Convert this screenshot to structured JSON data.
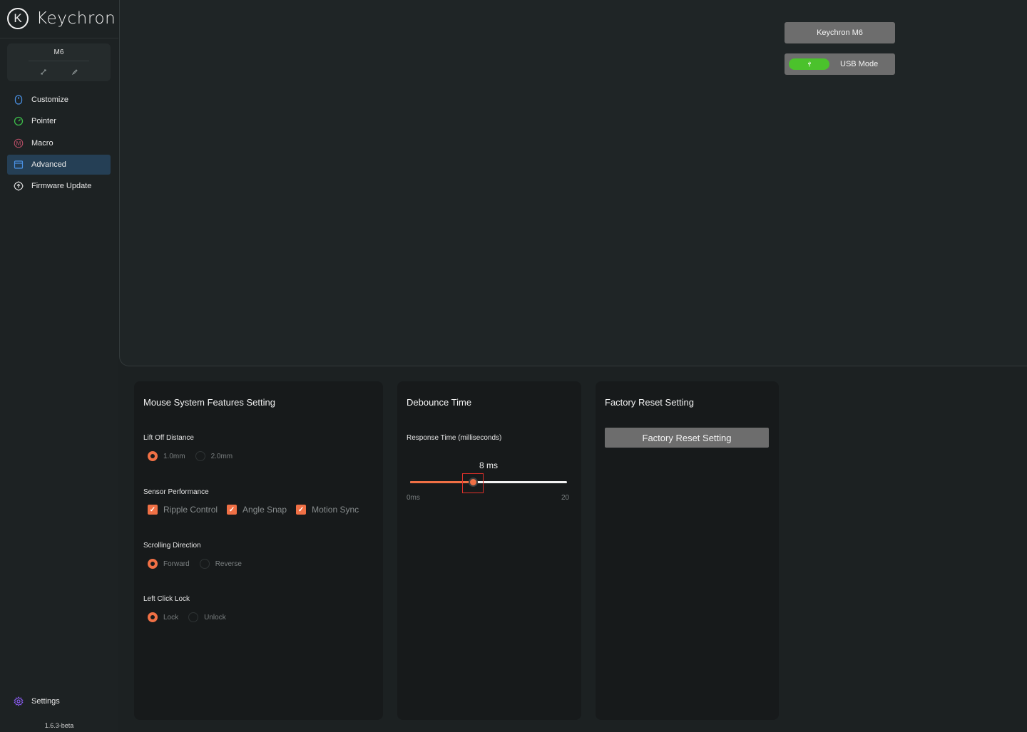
{
  "sidebar": {
    "brand": "Keychron",
    "device": {
      "name": "M6"
    },
    "nav": [
      {
        "label": "Customize",
        "icon": "mouse-icon",
        "color": "#4a90e2"
      },
      {
        "label": "Pointer",
        "icon": "pointer-speed-icon",
        "color": "#3dbb4a"
      },
      {
        "label": "Macro",
        "icon": "macro-m-icon",
        "color": "#c0506a"
      },
      {
        "label": "Advanced",
        "icon": "advanced-window-icon",
        "color": "#4a90e2",
        "active": true
      },
      {
        "label": "Firmware Update",
        "icon": "firmware-update-icon",
        "color": "#e6e6e6"
      }
    ],
    "settings_label": "Settings",
    "version": "1.6.3-beta"
  },
  "header": {
    "model_label": "Keychron M6",
    "mode_label": "USB Mode"
  },
  "features": {
    "title": "Mouse System Features Setting",
    "lift_off": {
      "label": "Lift Off Distance",
      "options": [
        "1.0mm",
        "2.0mm"
      ],
      "selected": "1.0mm"
    },
    "sensor": {
      "label": "Sensor Performance",
      "options": [
        "Ripple Control",
        "Angle Snap",
        "Motion Sync"
      ],
      "checked": [
        "Ripple Control",
        "Angle Snap",
        "Motion Sync"
      ]
    },
    "scrolling": {
      "label": "Scrolling Direction",
      "options": [
        "Forward",
        "Reverse"
      ],
      "selected": "Forward"
    },
    "click_lock": {
      "label": "Left Click Lock",
      "options": [
        "Lock",
        "Unlock"
      ],
      "selected": "Lock"
    }
  },
  "debounce": {
    "title": "Debounce Time",
    "label": "Response Time (milliseconds)",
    "value_text": "8 ms",
    "value": 8,
    "min": 0,
    "max": 20,
    "min_label": "0ms",
    "max_label": "20"
  },
  "reset": {
    "title": "Factory Reset Setting",
    "button_label": "Factory Reset Setting"
  },
  "colors": {
    "accent": "#f07045",
    "active_nav": "#253f55",
    "usb_green": "#4bc22c"
  }
}
